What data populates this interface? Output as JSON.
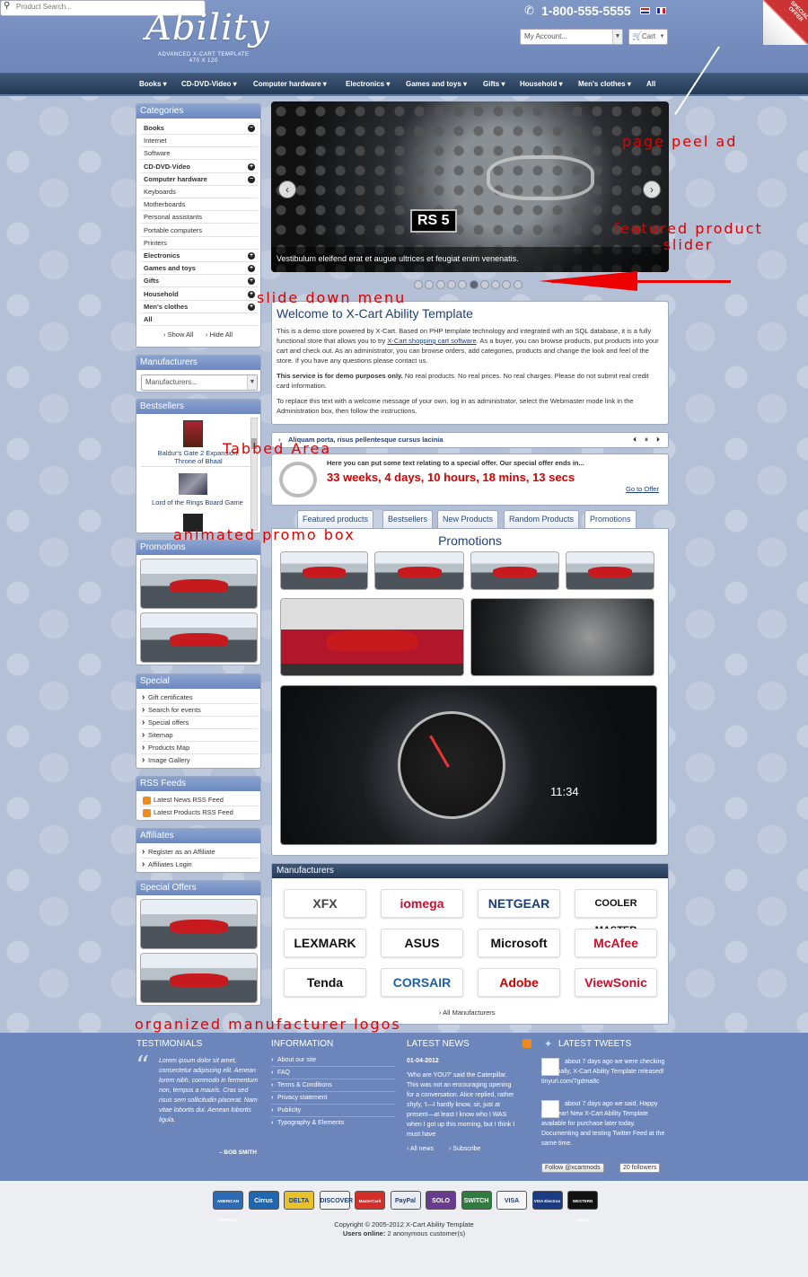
{
  "header": {
    "logo": "Ability",
    "logo_sub_1": "ADVANCED X-CART TEMPLATE",
    "logo_sub_2": "470 X 120",
    "phone": "1-800-555-5555",
    "account_select": "My Account...",
    "cart_select": "Cart",
    "search_placeholder": "Product Search...",
    "peel_text": "SPECIAL OFFER"
  },
  "nav": [
    "Books",
    "CD-DVD-Video",
    "Computer hardware",
    "Electronics",
    "Games and toys",
    "Gifts",
    "Household",
    "Men's clothes",
    "All"
  ],
  "categories": {
    "title": "Categories",
    "items": [
      {
        "label": "Books",
        "bold": true,
        "icon": "minus"
      },
      {
        "label": "Internet",
        "bold": false,
        "icon": ""
      },
      {
        "label": "Software",
        "bold": false,
        "icon": ""
      },
      {
        "label": "CD-DVD-Video",
        "bold": true,
        "icon": "plus"
      },
      {
        "label": "Computer hardware",
        "bold": true,
        "icon": "minus"
      },
      {
        "label": "Keyboards",
        "bold": false,
        "icon": ""
      },
      {
        "label": "Motherboards",
        "bold": false,
        "icon": ""
      },
      {
        "label": "Personal assistants",
        "bold": false,
        "icon": ""
      },
      {
        "label": "Portable computers",
        "bold": false,
        "icon": ""
      },
      {
        "label": "Printers",
        "bold": false,
        "icon": ""
      },
      {
        "label": "Electronics",
        "bold": true,
        "icon": "plus"
      },
      {
        "label": "Games and toys",
        "bold": true,
        "icon": "plus"
      },
      {
        "label": "Gifts",
        "bold": true,
        "icon": "plus"
      },
      {
        "label": "Household",
        "bold": true,
        "icon": "plus"
      },
      {
        "label": "Men's clothes",
        "bold": true,
        "icon": "plus"
      },
      {
        "label": "All",
        "bold": true,
        "icon": ""
      }
    ],
    "show_all": "Show All",
    "hide_all": "Hide All"
  },
  "manufacturers_box": {
    "title": "Manufacturers",
    "select": "Manufacturers..."
  },
  "bestsellers": {
    "title": "Bestsellers",
    "item1": "Baldur's Gate 2 Expansion: Throne of Bhaal",
    "item2": "Lord of the Rings Board Game"
  },
  "promotions_box": {
    "title": "Promotions"
  },
  "special": {
    "title": "Special",
    "items": [
      "Gift certificates",
      "Search for events",
      "Special offers",
      "Sitemap",
      "Products Map",
      "Image Gallery"
    ]
  },
  "rss": {
    "title": "RSS Feeds",
    "items": [
      "Latest News RSS Feed",
      "Latest Products RSS Feed"
    ]
  },
  "affiliates": {
    "title": "Affiliates",
    "items": [
      "Register as an Affiliate",
      "Affiliates Login"
    ]
  },
  "special_offers": {
    "title": "Special Offers"
  },
  "slider": {
    "caption": "Vestibulum eleifend erat et augue ultrices et feugiat enim venenatis.",
    "dots": 10,
    "active_dot": 5
  },
  "welcome": {
    "title": "Welcome to X-Cart Ability Template",
    "p1a": "This is a demo store powered by X-Cart. Based on PHP template technology and integrated with an SQL database, it is a fully functional store that allows you to try ",
    "p1link": "X-Cart shopping cart software",
    "p1b": ". As a buyer, you can browse products, put products into your cart and check out. As an administrator, you can browse orders, add categories, products and change the look and feel of the store. If you have any questions please contact us.",
    "p2bold": "This service is for demo purposes only.",
    "p2": " No real products. No real prices. No real charges. Please do not submit real credit card information.",
    "p3": "To replace this text with a welcome message of your own, log in as administrator, select the Webmaster mode link in the Administration box, then follow the instructions."
  },
  "ticker": "Aliquam porta, risus pellentesque cursus lacinia",
  "offer": {
    "text": "Here you can put some text relating to a special offer. Our special offer ends in...",
    "countdown": "33 weeks, 4 days, 10 hours, 18 mins, 13 secs",
    "link": "Go to Offer"
  },
  "tabs": [
    "Featured products",
    "Bestsellers",
    "New Products",
    "Random Products",
    "Promotions"
  ],
  "promotions_title": "Promotions",
  "manufacturers": {
    "title": "Manufacturers",
    "logos": [
      "XFX",
      "iomega",
      "NETGEAR",
      "COOLER MASTER",
      "LEXMARK",
      "ASUS",
      "Microsoft",
      "McAfee",
      "Tenda",
      "CORSAIR",
      "Adobe",
      "ViewSonic"
    ],
    "all_link": "All Manufacturers"
  },
  "footer": {
    "testimonials_title": "TESTIMONIALS",
    "testimonial": "Lorem ipsum dolor sit amet, consectetur adipiscing elit. Aenean lorem nibh, commodo in fermentum non, tempus a mauris. Cras sed risus sem sollicitudin placerat. Nam vitae lobortis dui. Aenean lobortis ligula.",
    "author": "– BOB SMITH",
    "info_title": "INFORMATION",
    "info_items": [
      "About our site",
      "FAQ",
      "Terms & Conditions",
      "Privacy statement",
      "Publicity",
      "Typography & Elements"
    ],
    "news_title": "LATEST NEWS",
    "news_date": "01-04-2012",
    "news_text": "'Who are YOU?' said the Caterpillar. This was not an encouraging opening for a conversation. Alice replied, rather shyly, 'I—I hardly know, sir, just at present—at least I know who I WAS when I got up this morning, but I think I must have",
    "all_news": "All news",
    "subscribe": "Subscribe",
    "tweets_title": "LATEST TWEETS",
    "tweet1": "about 7 days ago we were checking out Finally, X-Cart Ability Template released! tinyurl.com/7gdma8c",
    "tweet2": "about 7 days ago we said, Happy new year! New X-Cart Ability Template available for purchase later today. Documenting and testing Twitter Feed at the same time.",
    "follow": "Follow @xcartmods",
    "followers": "20 followers"
  },
  "cards": [
    {
      "name": "AMERICAN EXPRESS",
      "color": "#2b6cb5"
    },
    {
      "name": "Cirrus",
      "color": "#1f66b0"
    },
    {
      "name": "DELTA",
      "color": "#e8c22b"
    },
    {
      "name": "DISCOVER",
      "color": "#f2f2f2"
    },
    {
      "name": "MasterCard",
      "color": "#d52d27"
    },
    {
      "name": "PayPal",
      "color": "#e9edf3"
    },
    {
      "name": "SOLO",
      "color": "#6a3a8f"
    },
    {
      "name": "SWITCH",
      "color": "#2e7d3c"
    },
    {
      "name": "VISA",
      "color": "#f5f5f5"
    },
    {
      "name": "VISA Electron",
      "color": "#1b3b85"
    },
    {
      "name": "WESTERN UNION",
      "color": "#111111"
    }
  ],
  "copyright": "Copyright © 2005-2012 X-Cart Ability Template",
  "users_label": "Users online:",
  "users_value": "2 anonymous customer(s)",
  "annotations": {
    "peel": "page peel ad",
    "slider": "featured product slider",
    "menu": "slide down menu",
    "tabbed": "Tabbed Area",
    "promo": "animated promo box",
    "logos": "organized manufacturer logos"
  }
}
